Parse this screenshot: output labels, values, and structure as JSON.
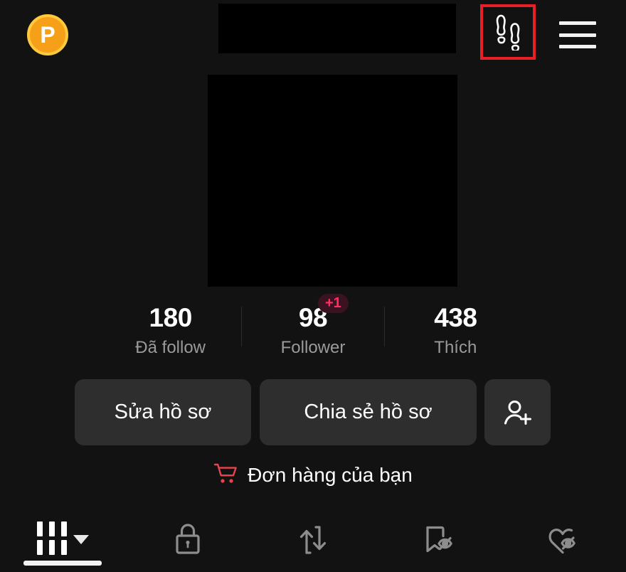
{
  "theme": {
    "background": "#121212",
    "redaction": "#000000",
    "text_primary": "#ffffff",
    "text_muted": "#9a9a9a",
    "button_bg": "#2e2e2e",
    "accent_red": "#e81f26",
    "badge_pink": "#ff2e63",
    "coin_orange": "#f6a01a",
    "coin_ring": "#ffc93c",
    "tab_inactive": "#8d8d8d",
    "tab_active": "#ffffff"
  },
  "header": {
    "coin_badge": {
      "letter": "P",
      "icon": "coin-p-icon"
    },
    "username_redacted": true,
    "footsteps_button": {
      "icon": "footprints-icon",
      "highlighted": true,
      "highlight_color": "#e81f26"
    },
    "menu_button": {
      "icon": "hamburger-menu-icon"
    }
  },
  "profile": {
    "photo_redacted": true,
    "stats": [
      {
        "value": "180",
        "label": "Đã follow",
        "badge": null
      },
      {
        "value": "98",
        "label": "Follower",
        "badge": "+1"
      },
      {
        "value": "438",
        "label": "Thích",
        "badge": null
      }
    ]
  },
  "actions": {
    "edit_profile_label": "Sửa hồ sơ",
    "share_profile_label": "Chia sẻ hồ sơ",
    "add_user_icon": "add-person-icon"
  },
  "orders": {
    "label": "Đơn hàng của bạn",
    "icon": "shopping-cart-icon",
    "icon_color": "#e8434f"
  },
  "tabs": [
    {
      "name": "posts-grid",
      "icon": "grid-posts-icon",
      "has_caret": true,
      "active": true
    },
    {
      "name": "private",
      "icon": "lock-icon",
      "has_caret": false,
      "active": false
    },
    {
      "name": "reposts",
      "icon": "repost-arrows-icon",
      "has_caret": false,
      "active": false
    },
    {
      "name": "saved-hidden",
      "icon": "bookmark-eye-off-icon",
      "has_caret": false,
      "active": false
    },
    {
      "name": "liked-hidden",
      "icon": "heart-eye-off-icon",
      "has_caret": false,
      "active": false
    }
  ]
}
